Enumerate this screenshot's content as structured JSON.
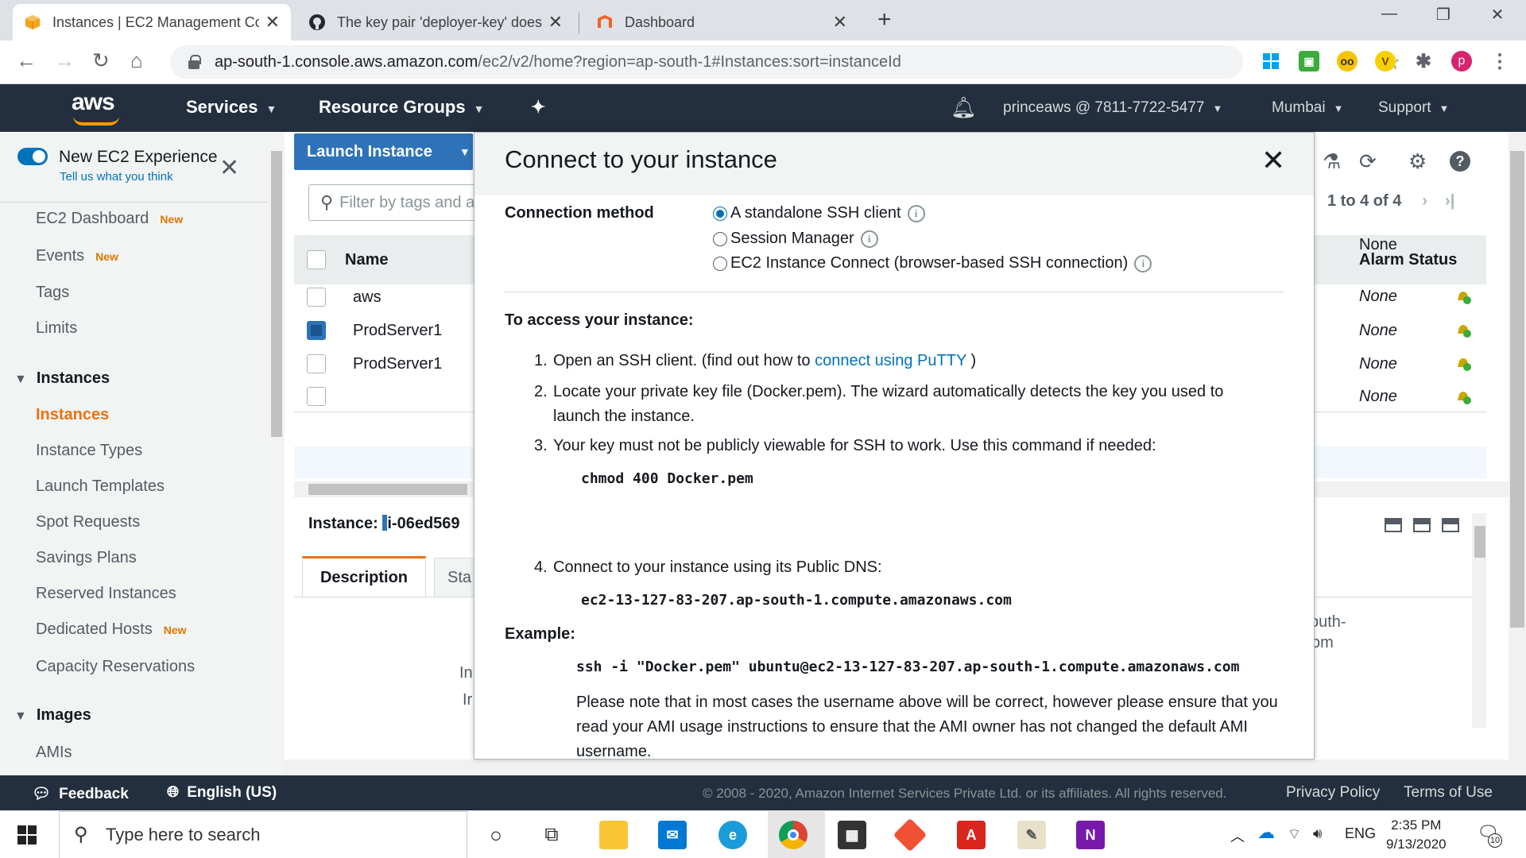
{
  "browser": {
    "tabs": [
      {
        "title": "Instances | EC2 Management Con",
        "icon": "aws-box-icon"
      },
      {
        "title": "The key pair 'deployer-key' does",
        "icon": "github-icon"
      },
      {
        "title": "Dashboard",
        "icon": "magento-icon"
      }
    ],
    "url_host": "ap-south-1.console.aws.amazon.com",
    "url_path": "/ec2/v2/home?region=ap-south-1#Instances:sort=instanceId",
    "profile_initial": "p"
  },
  "aws_nav": {
    "logo": "aws",
    "services": "Services",
    "resource_groups": "Resource Groups",
    "account": "princeaws @ 7811-7722-5477",
    "region": "Mumbai",
    "support": "Support"
  },
  "sidebar": {
    "new_experience": "New EC2 Experience",
    "tell_us": "Tell us what you think",
    "items_top": [
      {
        "label": "EC2 Dashboard",
        "badge": "New"
      },
      {
        "label": "Events",
        "badge": "New"
      },
      {
        "label": "Tags",
        "badge": ""
      },
      {
        "label": "Limits",
        "badge": ""
      }
    ],
    "instances_header": "Instances",
    "instances_items": [
      {
        "label": "Instances",
        "badge": ""
      },
      {
        "label": "Instance Types",
        "badge": ""
      },
      {
        "label": "Launch Templates",
        "badge": ""
      },
      {
        "label": "Spot Requests",
        "badge": ""
      },
      {
        "label": "Savings Plans",
        "badge": ""
      },
      {
        "label": "Reserved Instances",
        "badge": ""
      },
      {
        "label": "Dedicated Hosts",
        "badge": "New"
      },
      {
        "label": "Capacity Reservations",
        "badge": ""
      }
    ],
    "images_header": "Images",
    "images_items": [
      {
        "label": "AMIs"
      }
    ]
  },
  "main": {
    "launch_button": "Launch Instance",
    "filter_placeholder": "Filter by tags and a",
    "name_header": "Name",
    "alarm_header": "Alarm Status",
    "pager": "1 to 4 of 4",
    "rows": [
      {
        "name": "aws",
        "alarm": "None",
        "selected": false
      },
      {
        "name": "ProdServer1",
        "alarm": "None",
        "selected": true
      },
      {
        "name": "ProdServer1",
        "alarm": "None",
        "selected": false
      },
      {
        "name": "",
        "alarm": "None",
        "selected": false
      }
    ],
    "instance_label": "Instance:",
    "instance_id": "i-06ed569",
    "tab_description": "Description",
    "tab_status": "Sta",
    "partial_right_1": "outh-",
    "partial_right_2": "om",
    "partial_left_1": "In",
    "partial_left_2": "Ir"
  },
  "modal": {
    "title": "Connect to your instance",
    "connection_method_label": "Connection method",
    "options": [
      {
        "label": "A standalone SSH client",
        "selected": true
      },
      {
        "label": "Session Manager",
        "selected": false
      },
      {
        "label": "EC2 Instance Connect (browser-based SSH connection)",
        "selected": false
      }
    ],
    "access_heading": "To access your instance:",
    "step1_num": "1.",
    "step1_pre": "Open an SSH client. (find out how to ",
    "step1_link": "connect using PuTTY",
    "step1_post": ")",
    "step2_num": "2.",
    "step2": "Locate your private key file (Docker.pem). The wizard automatically detects the key you used to launch the instance.",
    "step3_num": "3.",
    "step3": "Your key must not be publicly viewable for SSH to work. Use this command if needed:",
    "chmod_cmd": "chmod 400 Docker.pem",
    "step4_num": "4.",
    "step4": "Connect to your instance using its Public DNS:",
    "public_dns": "ec2-13-127-83-207.ap-south-1.compute.amazonaws.com",
    "example_heading": "Example:",
    "example_cmd": "ssh -i \"Docker.pem\" ubuntu@ec2-13-127-83-207.ap-south-1.compute.amazonaws.com",
    "note": "Please note that in most cases the username above will be correct, however please ensure that you read your AMI usage instructions to ensure that the AMI owner has not changed the default AMI username."
  },
  "footer": {
    "feedback": "Feedback",
    "language": "English (US)",
    "copyright": "© 2008 - 2020, Amazon Internet Services Private Ltd. or its affiliates. All rights reserved.",
    "privacy": "Privacy Policy",
    "terms": "Terms of Use"
  },
  "taskbar": {
    "search_placeholder": "Type here to search",
    "language": "ENG",
    "time": "2:35 PM",
    "date": "9/13/2020",
    "notifications": "10"
  },
  "colors": {
    "aws_nav_bg": "#232f3e",
    "aws_orange": "#ec7211",
    "link_blue": "#0073bb",
    "launch_button": "#2e73b8"
  }
}
